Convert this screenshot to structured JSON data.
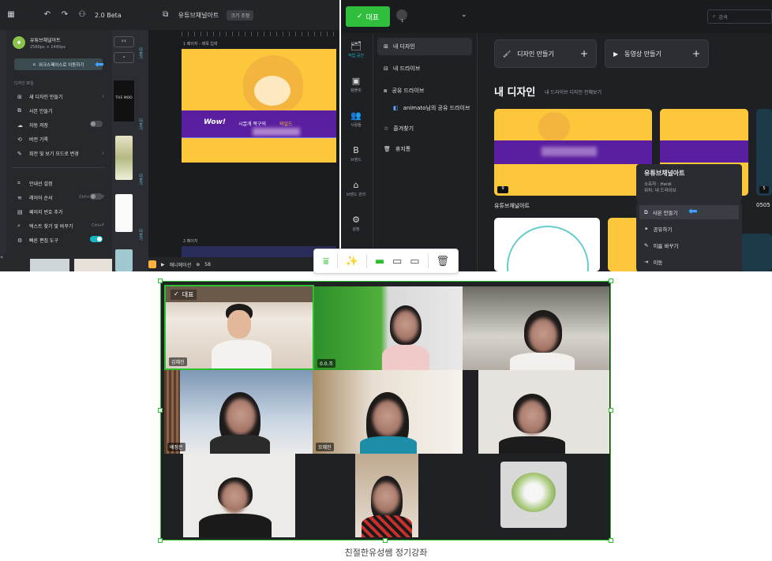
{
  "editor": {
    "version": "2.0 Beta",
    "file_name": "유튜브채널아트",
    "size_button": "크기 조정",
    "channel_name": "유튜브채널아트",
    "dimensions": "2560px × 1440px",
    "workspace_button": "워크스페이스로 이동하기",
    "section_label": "디자인 파일",
    "menu": [
      {
        "label": "새 디자인 만들기",
        "icon": "plus-square-icon"
      },
      {
        "label": "사본 만들기",
        "icon": "copy-icon"
      },
      {
        "label": "자동 저장",
        "icon": "cloud-icon"
      },
      {
        "label": "버전 기록",
        "icon": "history-icon"
      },
      {
        "label": "회전 및 보기 모드로 변경",
        "icon": "pen-icon"
      },
      {
        "label": "안내선 설정",
        "icon": "guide-icon"
      },
      {
        "label": "레이어 순서",
        "icon": "layers-icon",
        "shortcut": "Ctrl+Shift+Y"
      },
      {
        "label": "페이지 번호 추가",
        "icon": "page-number-icon"
      },
      {
        "label": "텍스트 찾기 및 바꾸기",
        "icon": "search-icon",
        "shortcut": "Ctrl+F"
      },
      {
        "label": "빠른 편집 도구",
        "icon": "gear-icon"
      }
    ],
    "page1_label": "1 페이지 - 제목 입력",
    "page2_label": "2 페이지",
    "banner_logo": "Wow!",
    "banner_text": "시끌개 목구의",
    "banner_highlight": "와일드",
    "animation_label": "애니메이션",
    "zoom": "58",
    "thumb_labels": [
      "더보기",
      "더보기",
      "더보기",
      "더보기"
    ],
    "thumb_brand": "THE MOO"
  },
  "dash": {
    "rep_button": "대표",
    "user_count": "1",
    "search_placeholder": "검색",
    "side_items": [
      "작업 공간",
      "템플릿",
      "사람들",
      "브랜드",
      "브랜드 관리",
      "설정"
    ],
    "nav": [
      "내 디자인",
      "내 드라이브",
      "공유 드라이브",
      "animato님의 공유 드라이브",
      "즐겨찾기",
      "휴지통"
    ],
    "create_design": "디자인 만들기",
    "create_video": "동영상 만들기",
    "section_title": "내 디자인",
    "section_sub": "내 드라이브 디자인 전체보기",
    "card_title": "유튜브채널아트",
    "card_count": "9",
    "card2_count": "5",
    "card3_title": "0505",
    "ctx": {
      "title": "유튜브채널아트",
      "owner": "소유자 : Heidi",
      "location": "위치: 내 드라이브",
      "items": [
        "사본 만들기",
        "공유하기",
        "이름 바꾸기",
        "이동"
      ]
    }
  },
  "meet": {
    "rep_label": "대표",
    "names": [
      "김혜진",
      "0.0.조",
      "",
      "배정은",
      "오혜진",
      "",
      "",
      "",
      ""
    ]
  },
  "caption": "친절한유성쌤 정기강좌",
  "colors": {
    "accent": "#17b4c3",
    "green": "#2dbf2d",
    "banner_purple": "#5a1fa0",
    "yellow": "#fcc73a"
  }
}
